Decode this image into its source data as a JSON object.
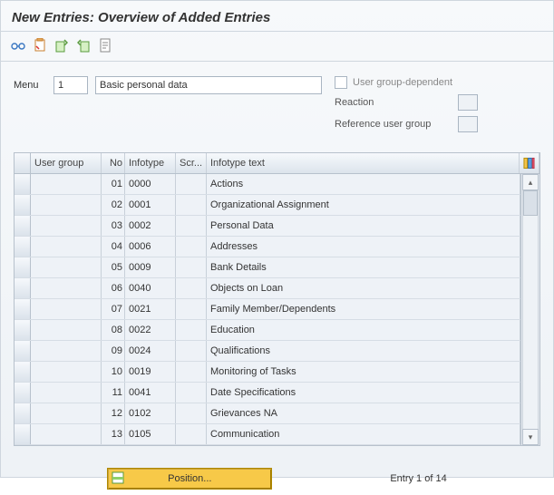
{
  "title": "New Entries: Overview of Added Entries",
  "toolbar_icons": [
    "glasses-icon",
    "clipboard-icon",
    "import-icon",
    "export-icon",
    "sheet-icon"
  ],
  "menu": {
    "label": "Menu",
    "num": "1",
    "text": "Basic personal data"
  },
  "user_group_dependent": {
    "label": "User group-dependent",
    "checked": false
  },
  "reaction": {
    "label": "Reaction",
    "value": ""
  },
  "ref_user_group": {
    "label": "Reference user group",
    "value": ""
  },
  "columns": {
    "user_group": "User group",
    "no": "No",
    "infotype": "Infotype",
    "screen": "Scr...",
    "infotype_text": "Infotype text"
  },
  "rows": [
    {
      "no": "01",
      "infotype": "0000",
      "text": "Actions"
    },
    {
      "no": "02",
      "infotype": "0001",
      "text": "Organizational Assignment"
    },
    {
      "no": "03",
      "infotype": "0002",
      "text": "Personal Data"
    },
    {
      "no": "04",
      "infotype": "0006",
      "text": "Addresses"
    },
    {
      "no": "05",
      "infotype": "0009",
      "text": "Bank Details"
    },
    {
      "no": "06",
      "infotype": "0040",
      "text": "Objects on Loan"
    },
    {
      "no": "07",
      "infotype": "0021",
      "text": "Family Member/Dependents"
    },
    {
      "no": "08",
      "infotype": "0022",
      "text": "Education"
    },
    {
      "no": "09",
      "infotype": "0024",
      "text": "Qualifications"
    },
    {
      "no": "10",
      "infotype": "0019",
      "text": "Monitoring of Tasks"
    },
    {
      "no": "11",
      "infotype": "0041",
      "text": "Date Specifications"
    },
    {
      "no": "12",
      "infotype": "0102",
      "text": "Grievances NA"
    },
    {
      "no": "13",
      "infotype": "0105",
      "text": "Communication"
    }
  ],
  "position_btn": "Position...",
  "entry_count": "Entry 1 of 14"
}
